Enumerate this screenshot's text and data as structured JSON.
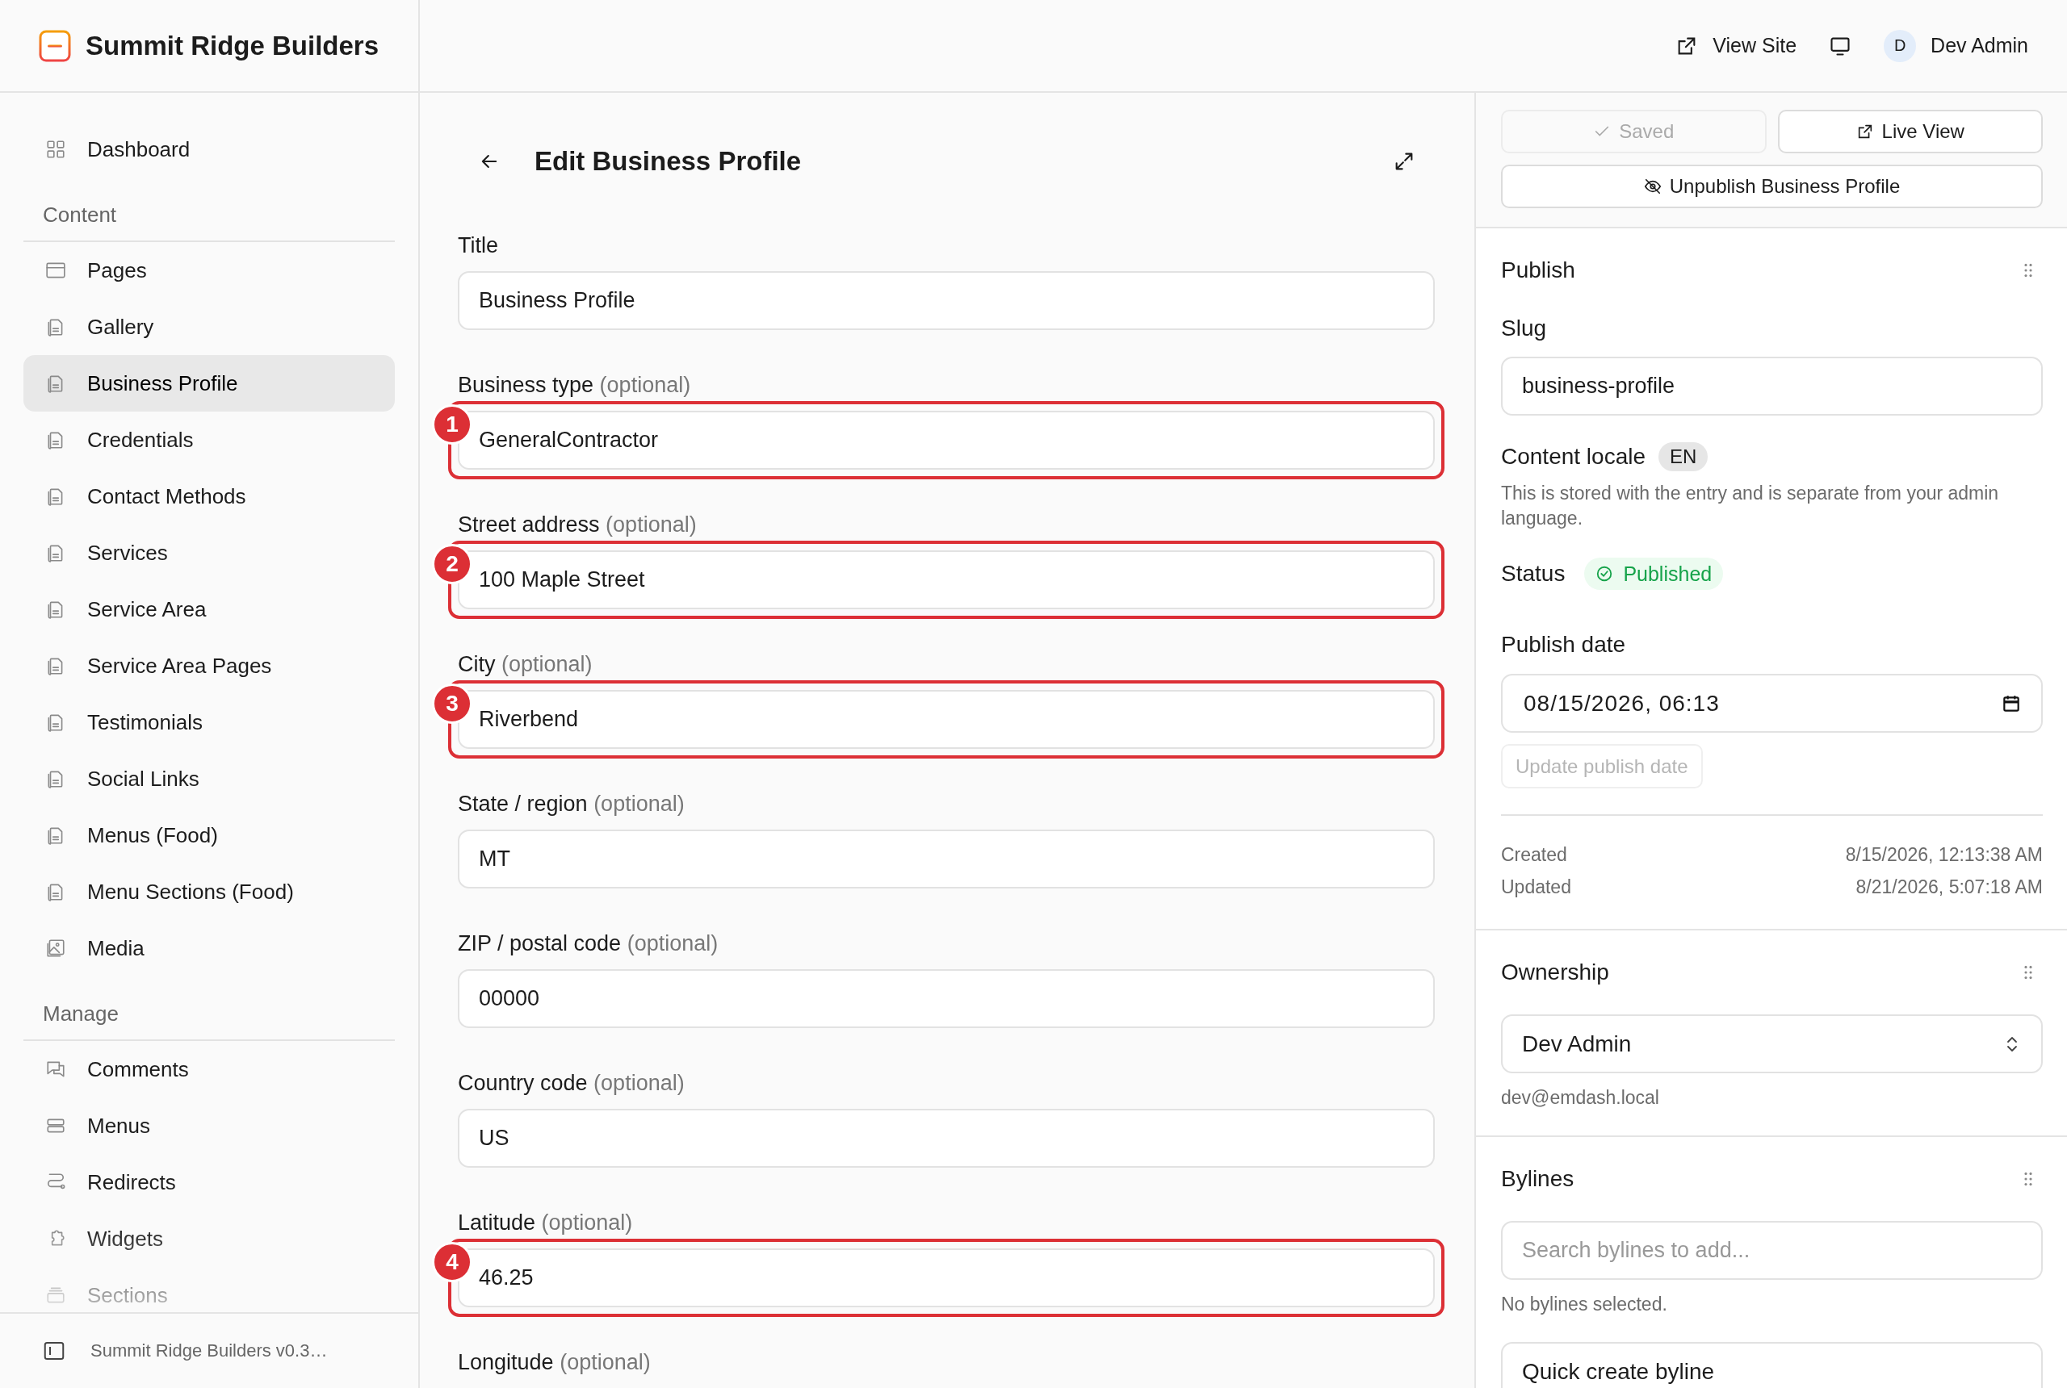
{
  "brand": {
    "name": "Summit Ridge Builders"
  },
  "top_bar": {
    "view_site": "View Site",
    "user": {
      "initial": "D",
      "name": "Dev Admin"
    }
  },
  "sidebar": {
    "top_items": [
      {
        "label": "Dashboard",
        "kind": "grid",
        "selected": false
      }
    ],
    "sections": [
      {
        "title": "Content",
        "items": [
          {
            "label": "Pages",
            "kind": "window",
            "selected": false
          },
          {
            "label": "Gallery",
            "kind": "document",
            "selected": false
          },
          {
            "label": "Business Profile",
            "kind": "document",
            "selected": true
          },
          {
            "label": "Credentials",
            "kind": "document",
            "selected": false
          },
          {
            "label": "Contact Methods",
            "kind": "document",
            "selected": false
          },
          {
            "label": "Services",
            "kind": "document",
            "selected": false
          },
          {
            "label": "Service Area",
            "kind": "document",
            "selected": false
          },
          {
            "label": "Service Area Pages",
            "kind": "document",
            "selected": false
          },
          {
            "label": "Testimonials",
            "kind": "document",
            "selected": false
          },
          {
            "label": "Social Links",
            "kind": "document",
            "selected": false
          },
          {
            "label": "Menus (Food)",
            "kind": "document",
            "selected": false
          },
          {
            "label": "Menu Sections (Food)",
            "kind": "document",
            "selected": false
          },
          {
            "label": "Media",
            "kind": "image",
            "selected": false
          }
        ]
      },
      {
        "title": "Manage",
        "items": [
          {
            "label": "Comments",
            "kind": "chat",
            "selected": false
          },
          {
            "label": "Menus",
            "kind": "rows",
            "selected": false
          },
          {
            "label": "Redirects",
            "kind": "route",
            "selected": false
          },
          {
            "label": "Widgets",
            "kind": "puzzle",
            "selected": false
          },
          {
            "label": "Sections",
            "kind": "layers",
            "selected": false
          }
        ]
      }
    ],
    "footer": "Summit Ridge Builders v0.3…"
  },
  "editor": {
    "title": "Edit Business Profile",
    "fields": [
      {
        "label": "Title",
        "value": "Business Profile"
      },
      {
        "label": "Business type",
        "optional": "(optional)",
        "value": "GeneralContractor",
        "marker": "1"
      },
      {
        "label": "Street address",
        "optional": "(optional)",
        "value": "100 Maple Street",
        "marker": "2"
      },
      {
        "label": "City",
        "optional": "(optional)",
        "value": "Riverbend",
        "marker": "3"
      },
      {
        "label": "State / region",
        "optional": "(optional)",
        "value": "MT"
      },
      {
        "label": "ZIP / postal code",
        "optional": "(optional)",
        "value": "00000"
      },
      {
        "label": "Country code",
        "optional": "(optional)",
        "value": "US"
      },
      {
        "label": "Latitude",
        "optional": "(optional)",
        "value": "46.25",
        "marker": "4"
      },
      {
        "label": "Longitude",
        "optional": "(optional)"
      }
    ]
  },
  "side_panel": {
    "actions": [
      {
        "label": "Saved",
        "kind": "saved",
        "disabled": true
      },
      {
        "label": "Live View",
        "kind": "live",
        "disabled": false
      },
      {
        "label": "Unpublish Business Profile",
        "kind": "unpublish",
        "disabled": false
      }
    ],
    "publish": {
      "title": "Publish",
      "slug_label": "Slug",
      "slug": "business-profile",
      "locale_label": "Content locale",
      "locale": "EN",
      "locale_note": "This is stored with the entry and is separate from your admin language.",
      "status_label": "Status",
      "status": {
        "label": "Published",
        "kind": "published"
      },
      "date_label": "Publish date",
      "date": "08/15/2026, 06:13",
      "update_button": {
        "label": "Update publish date",
        "disabled": true
      },
      "meta": [
        {
          "label": "Created",
          "value": "8/15/2026, 12:13:38 AM"
        },
        {
          "label": "Updated",
          "value": "8/21/2026, 5:07:18 AM"
        }
      ]
    },
    "ownership": {
      "title": "Ownership",
      "owner": "Dev Admin",
      "email": "dev@emdash.local"
    },
    "bylines": {
      "title": "Bylines",
      "placeholder": "Search bylines to add...",
      "empty_note": "No bylines selected.",
      "quick_create": "Quick create byline"
    }
  }
}
